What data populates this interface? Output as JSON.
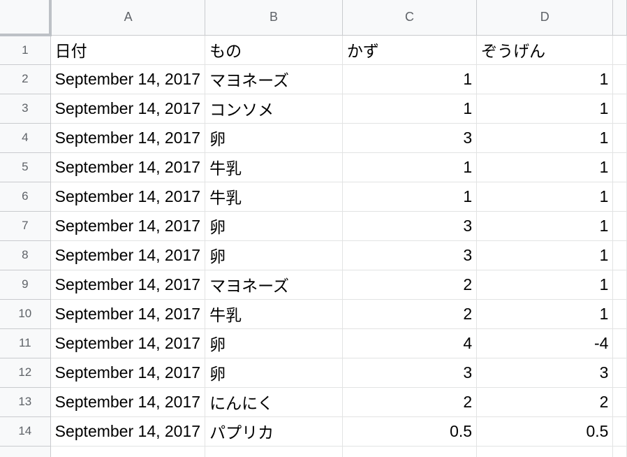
{
  "columns": [
    "A",
    "B",
    "C",
    "D"
  ],
  "rows": [
    {
      "num": "1",
      "a": "日付",
      "b": "もの",
      "c": "かず",
      "d": "ぞうげん"
    },
    {
      "num": "2",
      "a": "September 14, 2017",
      "b": "マヨネーズ",
      "c": "1",
      "d": "1"
    },
    {
      "num": "3",
      "a": "September 14, 2017",
      "b": "コンソメ",
      "c": "1",
      "d": "1"
    },
    {
      "num": "4",
      "a": "September 14, 2017",
      "b": "卵",
      "c": "3",
      "d": "1"
    },
    {
      "num": "5",
      "a": "September 14, 2017",
      "b": "牛乳",
      "c": "1",
      "d": "1"
    },
    {
      "num": "6",
      "a": "September 14, 2017",
      "b": "牛乳",
      "c": "1",
      "d": "1"
    },
    {
      "num": "7",
      "a": "September 14, 2017",
      "b": "卵",
      "c": "3",
      "d": "1"
    },
    {
      "num": "8",
      "a": "September 14, 2017",
      "b": "卵",
      "c": "3",
      "d": "1"
    },
    {
      "num": "9",
      "a": "September 14, 2017",
      "b": "マヨネーズ",
      "c": "2",
      "d": "1"
    },
    {
      "num": "10",
      "a": "September 14, 2017",
      "b": "牛乳",
      "c": "2",
      "d": "1"
    },
    {
      "num": "11",
      "a": "September 14, 2017",
      "b": "卵",
      "c": "4",
      "d": "-4"
    },
    {
      "num": "12",
      "a": "September 14, 2017",
      "b": "卵",
      "c": "3",
      "d": "3"
    },
    {
      "num": "13",
      "a": "September 14, 2017",
      "b": "にんにく",
      "c": "2",
      "d": "2"
    },
    {
      "num": "14",
      "a": "September 14, 2017",
      "b": "パプリカ",
      "c": "0.5",
      "d": "0.5"
    }
  ]
}
